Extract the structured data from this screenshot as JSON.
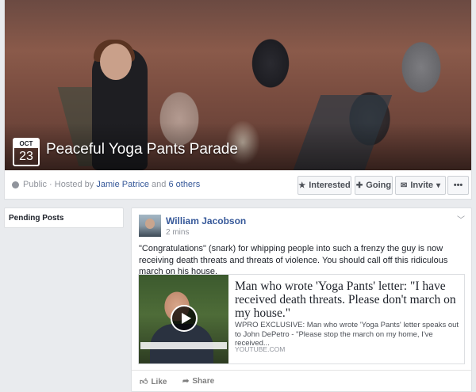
{
  "event": {
    "date_month": "OCT",
    "date_day": "23",
    "title": "Peaceful Yoga Pants Parade",
    "privacy": "Public",
    "hosted_by_prefix": "· Hosted by",
    "host_name": "Jamie Patrice",
    "and_text": "and",
    "others_link": "6 others"
  },
  "actions": {
    "interested_label": "Interested",
    "going_label": "Going",
    "invite_label": "Invite",
    "more_label": "•••"
  },
  "sidebar": {
    "pending_posts_label": "Pending Posts"
  },
  "post": {
    "author": "William Jacobson",
    "timestamp": "2 mins",
    "text": "\"Congratulations\" (snark) for whipping people into such a frenzy the guy is now receiving death threats and threats of violence. You should call off this ridiculous march on his house.",
    "link": {
      "title": "Man who wrote 'Yoga Pants' letter: \"I have received death threats. Please don't march on my house.\"",
      "description": "WPRO EXCLUSIVE: Man who wrote 'Yoga Pants' letter speaks out to John DePetro - \"Please stop the march on my home, I've received...",
      "domain": "YOUTUBE.COM"
    },
    "like_label": "Like",
    "share_label": "Share"
  },
  "icons": {
    "globe": "globe-icon",
    "star": "star-icon",
    "plus": "plus-icon",
    "envelope": "envelope-icon",
    "chevron": "chevron-down-icon",
    "play": "play-icon",
    "thumbs_up": "thumbs-up-icon",
    "share_arrow": "share-arrow-icon"
  },
  "colors": {
    "link_blue": "#365899",
    "background": "#e9ebee",
    "muted_text": "#90949c"
  }
}
